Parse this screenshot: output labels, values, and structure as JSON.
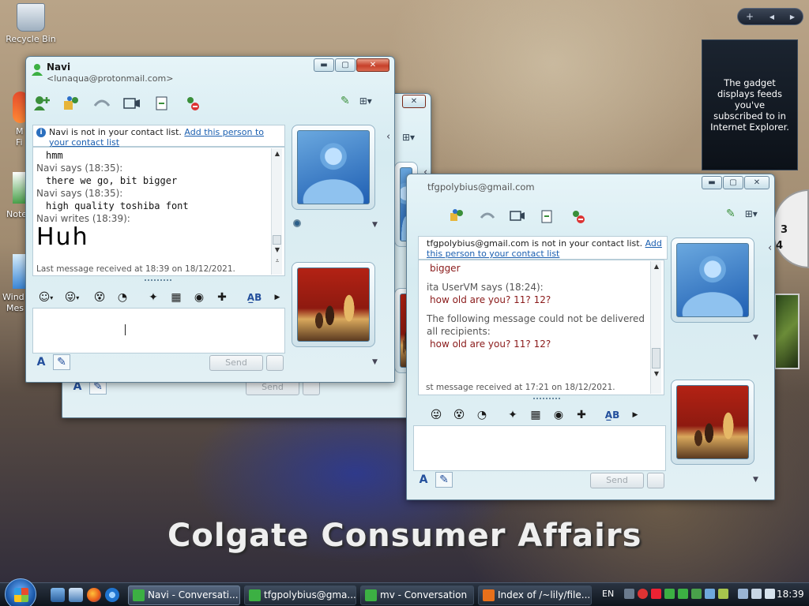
{
  "desktop": {
    "recycle_bin": "Recycle Bin",
    "frag_a": "M",
    "frag_b": "Fi",
    "frag_c": "Note",
    "frag_d": "Wind",
    "frag_e": "Mes"
  },
  "sidebar": {
    "plus": "+",
    "prev": "◀",
    "next": "▶",
    "gadget_text": "The gadget displays feeds you've subscribed to in Internet Explorer.",
    "clock_digits": [
      "3",
      "4"
    ]
  },
  "caption": "Colgate Consumer Affairs",
  "win_navi": {
    "name": "Navi",
    "email": "<lunaqua@protonmail.com>",
    "notice_text": "Navi is not in your contact list.",
    "notice_link": "Add this person to your contact list",
    "messages": [
      {
        "head": "",
        "body": "hmm"
      },
      {
        "head": "Navi says (18:35):",
        "body": "there we go, bit bigger"
      },
      {
        "head": "Navi says (18:35):",
        "body": "high quality toshiba font"
      },
      {
        "head": "Navi writes (18:39):",
        "body": ""
      }
    ],
    "handwriting": "Huh",
    "last_received": "Last message received at 18:39 on 18/12/2021.",
    "send": "Send"
  },
  "win_mv": {
    "send": "Send"
  },
  "win_tfg": {
    "email": "tfgpolybius@gmail.com",
    "notice_text": "tfgpolybius@gmail.com is not in your contact list.",
    "notice_link": "Add this person to your contact list",
    "messages": [
      {
        "kind": "body",
        "text": "bigger"
      },
      {
        "kind": "head",
        "text": "ita UserVM says (18:24):"
      },
      {
        "kind": "body",
        "text": "how old are you? 11? 12?"
      },
      {
        "kind": "head",
        "text": "The following message could not be delivered"
      },
      {
        "kind": "head",
        "text": "all recipients:"
      },
      {
        "kind": "body",
        "text": "how old are you? 11? 12?"
      }
    ],
    "last_received": "st message received at 17:21 on 18/12/2021.",
    "send": "Send"
  },
  "taskbar": {
    "tasks": [
      {
        "label": "Navi - Conversati...",
        "color": "#3cb043"
      },
      {
        "label": "tfgpolybius@gma...",
        "color": "#3cb043"
      },
      {
        "label": "mv - Conversation",
        "color": "#3cb043"
      },
      {
        "label": "Index of /~lily/file...",
        "color": "#e8701a"
      }
    ],
    "lang": "EN",
    "clock": "18:39"
  },
  "colors": {
    "link": "#1b5fb0",
    "title_bar": "#e6f4f8",
    "close_red": "#c7402a"
  }
}
